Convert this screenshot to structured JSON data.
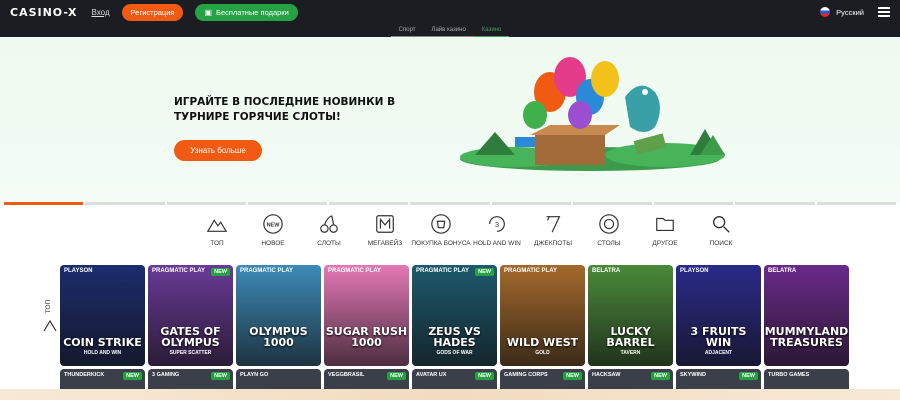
{
  "header": {
    "logo": "CASINO-X",
    "login": "Вход",
    "register": "Регистрация",
    "gifts": "Бесплатные подарки",
    "language": "Русский"
  },
  "subnav": [
    "Спорт",
    "Лайв казино",
    "Казино"
  ],
  "hero": {
    "title": "Играйте в последние новинки в турнире Горячие слоты!",
    "button": "Узнать больше"
  },
  "categories": [
    {
      "label": "ТОП",
      "icon": "mountain-icon"
    },
    {
      "label": "НОВОЕ",
      "icon": "new-icon"
    },
    {
      "label": "СЛОТЫ",
      "icon": "cherry-icon"
    },
    {
      "label": "МЕГАВЕЙЗ",
      "icon": "megaways-icon"
    },
    {
      "label": "ПОКУПКА БОНУСА",
      "icon": "bonus-icon"
    },
    {
      "label": "HOLD AND WIN",
      "icon": "hold-win-icon"
    },
    {
      "label": "ДЖЕКПОТЫ",
      "icon": "jackpot-icon"
    },
    {
      "label": "СТОЛЫ",
      "icon": "chip-icon"
    },
    {
      "label": "ДРУГОЕ",
      "icon": "folder-icon"
    },
    {
      "label": "ПОИСК",
      "icon": "search-icon"
    }
  ],
  "side_label": "ТОП",
  "games": [
    {
      "provider": "PLAYSON",
      "title": "COIN STRIKE",
      "sub": "HOLD AND WIN",
      "badge": "",
      "color": "#1c2c6e"
    },
    {
      "provider": "PRAGMATIC PLAY",
      "title": "GATES OF OLYMPUS",
      "sub": "SUPER SCATTER",
      "badge": "NEW",
      "color": "#6a3a98"
    },
    {
      "provider": "PRAGMATIC PLAY",
      "title": "OLYMPUS 1000",
      "sub": "",
      "badge": "",
      "color": "#3d8ab8"
    },
    {
      "provider": "PRAGMATIC PLAY",
      "title": "SUGAR RUSH 1000",
      "sub": "",
      "badge": "",
      "color": "#e478b6"
    },
    {
      "provider": "PRAGMATIC PLAY",
      "title": "ZEUS VS HADES",
      "sub": "GODS OF WAR",
      "badge": "NEW",
      "color": "#1d5a6e"
    },
    {
      "provider": "PRAGMATIC PLAY",
      "title": "WILD WEST",
      "sub": "GOLD",
      "badge": "",
      "color": "#a56a2c"
    },
    {
      "provider": "BELATRA",
      "title": "LUCKY BARREL",
      "sub": "TAVERN",
      "badge": "",
      "color": "#4a8a3a"
    },
    {
      "provider": "PLAYSON",
      "title": "3 FRUITS WIN",
      "sub": "ADJACENT",
      "badge": "",
      "color": "#2a2a8a"
    },
    {
      "provider": "BELATRA",
      "title": "MUMMYLAND TREASURES",
      "sub": "",
      "badge": "",
      "color": "#6a2a8a"
    }
  ],
  "games_row2": [
    {
      "provider": "THUNDERKICK",
      "badge": "NEW"
    },
    {
      "provider": "3 GAMING",
      "badge": "NEW"
    },
    {
      "provider": "PLAYN GO",
      "badge": ""
    },
    {
      "provider": "VEGGBRASIL",
      "badge": "NEW"
    },
    {
      "provider": "AVATAR UX",
      "badge": "NEW"
    },
    {
      "provider": "GAMING CORPS",
      "badge": "NEW"
    },
    {
      "provider": "HACKSAW",
      "badge": "NEW"
    },
    {
      "provider": "SKYWIND",
      "badge": "NEW"
    },
    {
      "provider": "TURBO GAMES",
      "badge": ""
    }
  ],
  "colors": {
    "accent": "#f05a12",
    "green": "#25a243",
    "dark": "#1b1d22"
  }
}
